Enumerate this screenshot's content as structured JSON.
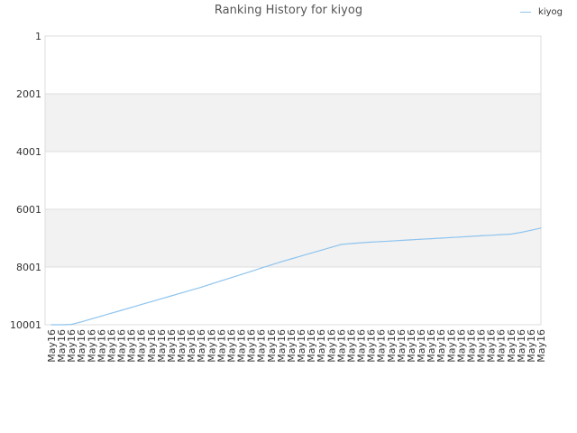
{
  "chart_data": {
    "type": "line",
    "title": "Ranking History for kiyog",
    "xlabel": "",
    "ylabel": "",
    "y_inverted": true,
    "ylim": [
      1,
      10001
    ],
    "y_ticks": [
      "1",
      "2001",
      "4001",
      "6001",
      "8001",
      "10001"
    ],
    "grid": "alternating horizontal bands",
    "legend_position": "top-right",
    "x": [
      "May16",
      "May16",
      "May16",
      "May16",
      "May16",
      "May16",
      "May16",
      "May16",
      "May16",
      "May16",
      "May16",
      "May16",
      "May16",
      "May16",
      "May16",
      "May16",
      "May16",
      "May16",
      "May16",
      "May16",
      "May16",
      "May16",
      "May16",
      "May16",
      "May16",
      "May16",
      "May16",
      "May16",
      "May16",
      "May16",
      "May16",
      "May16",
      "May16",
      "May16",
      "May16",
      "May16",
      "May16",
      "May16",
      "May16",
      "May16",
      "May16",
      "May16",
      "May16",
      "May16",
      "May16",
      "May16",
      "May16",
      "May16",
      "May16",
      "May16"
    ],
    "series": [
      {
        "name": "kiyog",
        "color": "#8ec4ee",
        "values": [
          10001,
          10001,
          9990,
          9900,
          9800,
          9700,
          9600,
          9500,
          9400,
          9300,
          9200,
          9100,
          9000,
          8900,
          8800,
          8700,
          8590,
          8480,
          8370,
          8260,
          8150,
          8040,
          7930,
          7820,
          7720,
          7620,
          7520,
          7420,
          7320,
          7220,
          7190,
          7160,
          7140,
          7120,
          7100,
          7080,
          7060,
          7040,
          7020,
          7000,
          6980,
          6960,
          6940,
          6920,
          6900,
          6880,
          6860,
          6800,
          6730,
          6650
        ]
      }
    ]
  }
}
